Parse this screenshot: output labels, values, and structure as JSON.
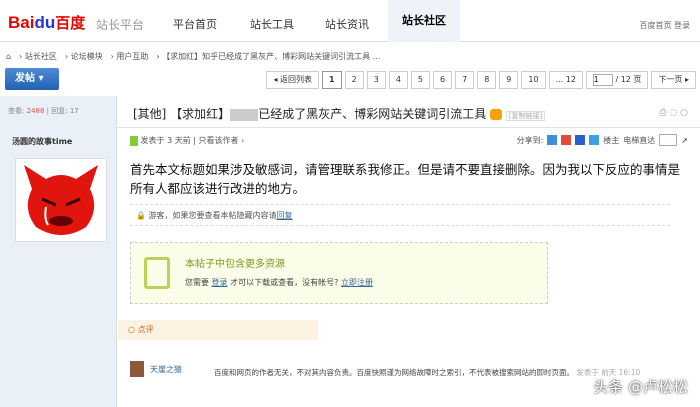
{
  "header": {
    "logo": "Bai",
    "logo_paw": "du",
    "logo_cn": "百度",
    "platform": "站长平台",
    "nav": [
      "平台首页",
      "站长工具",
      "站长资讯",
      "站长社区"
    ],
    "links": [
      "百度首页",
      "登录"
    ]
  },
  "breadcrumb": [
    "站长社区",
    "论坛模块",
    "用户互助",
    "【求加红】知乎已经成了黑灰产、博彩网站关键词引流工具 ..."
  ],
  "toolbar": {
    "post": "发帖 ▾",
    "back": "◂ 返回列表",
    "pages": [
      "1",
      "2",
      "3",
      "4",
      "5",
      "6",
      "7",
      "8",
      "9",
      "10",
      "... 12"
    ],
    "page_input": "1",
    "total": "/ 12 页",
    "next": "下一页 ▸"
  },
  "sidebar": {
    "views_label": "查看:",
    "views": "2488",
    "replies_label": "回复:",
    "replies": "17",
    "author": "汤圆的故事time"
  },
  "post": {
    "title_prefix": "[其他] 【求加红】",
    "title_rest": "已经成了黑灰产、博彩网站关键词引流工具",
    "tag": "[复制链接]",
    "meta_posted": "发表于 3 天前",
    "meta_author": "只看该作者 ›",
    "share": "分享到:",
    "floor": "楼主",
    "elevator": "电梯直达",
    "content": "首先本文标题如果涉及敏感词，请管理联系我修正。但是请不要直接删除。因为我以下反应的事情是所有人都应该进行改进的地方。",
    "notice": "游客，如果您要查看本帖隐藏内容请",
    "notice_link": "回复",
    "res_title": "本帖子中包含更多资源",
    "res_text": "您需要",
    "res_login": "登录",
    "res_text2": "才可以下载或查看，没有帐号?",
    "res_reg": "立即注册"
  },
  "review": {
    "label": "点评",
    "name": "天崖之猿",
    "text": "百度和网页的作者无关，不对其内容负责。百度快照谨为网络故障时之索引，不代表被搜索网站的即时页面。",
    "time": "发表于 前天 16:10"
  },
  "watermark": "头条 @卢松松"
}
